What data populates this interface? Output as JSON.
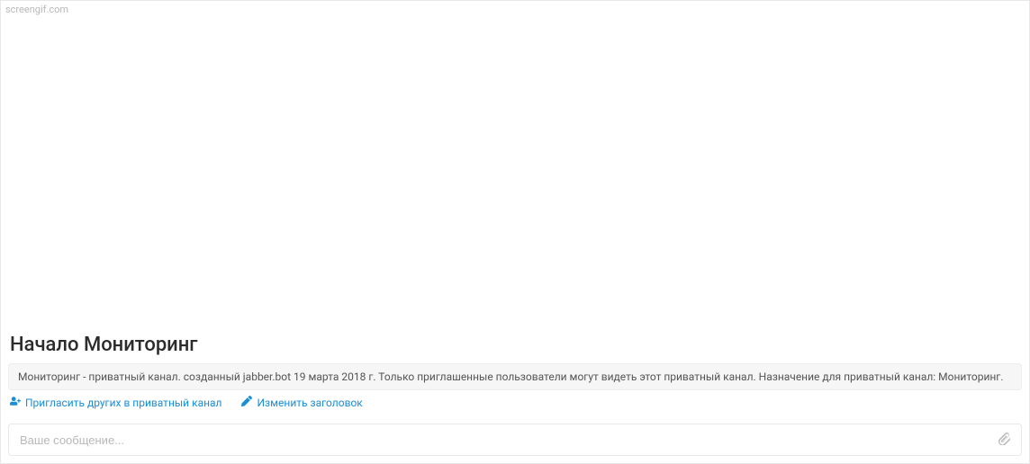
{
  "watermark": "screengif.com",
  "channel_start": {
    "title": "Начало Мониторинг",
    "description": "Мониторинг - приватный канал. созданный jabber.bot 19 марта 2018 г. Только приглашенные пользователи могут видеть этот приватный канал. Назначение для приватный канал: Мониторинг."
  },
  "actions": {
    "invite_label": "Пригласить других в приватный канал",
    "edit_title_label": "Изменить заголовок"
  },
  "composer": {
    "placeholder": "Ваше сообщение..."
  }
}
